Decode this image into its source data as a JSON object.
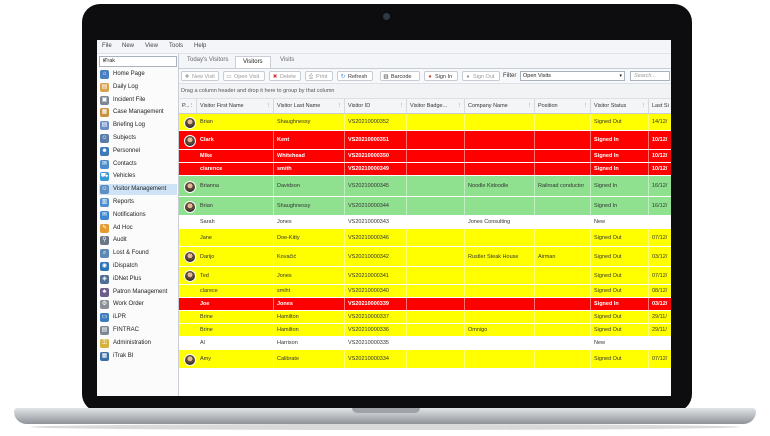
{
  "menu": [
    "File",
    "New",
    "View",
    "Tools",
    "Help"
  ],
  "sidebar": {
    "header": "iTrak",
    "items": [
      {
        "label": "Home Page",
        "icon": "home-icon",
        "color": "#4a7fc1"
      },
      {
        "label": "Daily Log",
        "icon": "daily-log-icon",
        "color": "#d9a14a"
      },
      {
        "label": "Incident File",
        "icon": "incident-file-icon",
        "color": "#7b8593"
      },
      {
        "label": "Case Management",
        "icon": "case-management-icon",
        "color": "#c9913d"
      },
      {
        "label": "Briefing Log",
        "icon": "briefing-log-icon",
        "color": "#6b8fc4"
      },
      {
        "label": "Subjects",
        "icon": "subjects-icon",
        "color": "#5a7ca8"
      },
      {
        "label": "Personnel",
        "icon": "personnel-icon",
        "color": "#3f7bb8"
      },
      {
        "label": "Contacts",
        "icon": "contacts-icon",
        "color": "#4c8bc9"
      },
      {
        "label": "Vehicles",
        "icon": "vehicles-icon",
        "color": "#3a9ad9"
      },
      {
        "label": "Visitor Management",
        "icon": "visitor-management-icon",
        "color": "#5f8ec2",
        "active": true
      },
      {
        "label": "Reports",
        "icon": "reports-icon",
        "color": "#4d8fd1"
      },
      {
        "label": "Notifications",
        "icon": "notifications-icon",
        "color": "#3f86d0"
      },
      {
        "label": "Ad Hoc",
        "icon": "ad-hoc-icon",
        "color": "#e39b2d"
      },
      {
        "label": "Audit",
        "icon": "audit-icon",
        "color": "#6a7686"
      },
      {
        "label": "Lost & Found",
        "icon": "lost-found-icon",
        "color": "#5e88b6"
      },
      {
        "label": "iDispatch",
        "icon": "idispatch-icon",
        "color": "#2f74b5"
      },
      {
        "label": "iDNet Plus",
        "icon": "idnet-plus-icon",
        "color": "#4e6f93"
      },
      {
        "label": "Patron Management",
        "icon": "patron-management-icon",
        "color": "#6b5f8a"
      },
      {
        "label": "Work Order",
        "icon": "work-order-icon",
        "color": "#8a8f96"
      },
      {
        "label": "iLPR",
        "icon": "ilpr-icon",
        "color": "#3d7dbf"
      },
      {
        "label": "FINTRAC",
        "icon": "fintrac-icon",
        "color": "#7d8793"
      },
      {
        "label": "Administration",
        "icon": "administration-icon",
        "color": "#d8b13a"
      },
      {
        "label": "iTrak BI",
        "icon": "itrak-bi-icon",
        "color": "#3c6fa6"
      }
    ]
  },
  "tabs": [
    {
      "label": "Today's Visitors"
    },
    {
      "label": "Visitors",
      "active": true
    },
    {
      "label": "Visits"
    }
  ],
  "toolbar": {
    "new_visit": "New Visit",
    "open_visit": "Open Visit",
    "delete": "Delete",
    "print": "Print",
    "refresh": "Refresh",
    "barcode": "Barcode",
    "sign_in": "Sign In",
    "sign_out": "Sign Out",
    "filter_label": "Filter",
    "filter_value": "Open Visits",
    "search_placeholder": "Search..."
  },
  "group_hint": "Drag a column header and drop it here to group by that column",
  "columns": [
    "P...",
    "Visitor First Name",
    "Visitor Last Name",
    "Visitor ID",
    "Visitor Badge...",
    "Company Name",
    "Position",
    "Visitor Status",
    "Last Si"
  ],
  "status_colors": {
    "yellow": "#ffff00",
    "red": "#ff0000",
    "green": "#8fe08f",
    "white": "#ffffff"
  },
  "rows": [
    {
      "first": "Brian",
      "last": "Shaughnessy",
      "id": "VS20210000352",
      "badge": "",
      "company": "",
      "position": "",
      "status": "Signed Out",
      "last_sign": "14/12/",
      "color": "yellow",
      "photo": true
    },
    {
      "first": "Clark",
      "last": "Kent",
      "id": "VS20210000351",
      "badge": "",
      "company": "",
      "position": "",
      "status": "Signed In",
      "last_sign": "10/12/",
      "color": "red",
      "photo": true
    },
    {
      "first": "Mike",
      "last": "Whitehead",
      "id": "VS20210000350",
      "badge": "",
      "company": "",
      "position": "",
      "status": "Signed In",
      "last_sign": "10/12/",
      "color": "red",
      "photo": false
    },
    {
      "first": "clarence",
      "last": "smith",
      "id": "VS20210000349",
      "badge": "",
      "company": "",
      "position": "",
      "status": "Signed In",
      "last_sign": "10/12/",
      "color": "red",
      "photo": false
    },
    {
      "first": "Brianna",
      "last": "Davidson",
      "id": "VS20210000345",
      "badge": "",
      "company": "Noodle Kidoodle",
      "position": "Railroad conductor",
      "status": "Signed In",
      "last_sign": "16/12/",
      "color": "green",
      "photo": true
    },
    {
      "first": "Brian",
      "last": "Shaughnessy",
      "id": "VS20210000344",
      "badge": "",
      "company": "",
      "position": "",
      "status": "Signed In",
      "last_sign": "16/12/",
      "color": "green",
      "photo": true
    },
    {
      "first": "Sarah",
      "last": "Jones",
      "id": "VS20210000343",
      "badge": "",
      "company": "Jones Consulting",
      "position": "",
      "status": "New",
      "last_sign": "",
      "color": "white",
      "photo": false
    },
    {
      "first": "Jane",
      "last": "Doe-Kitty",
      "id": "VS20210000346",
      "badge": "",
      "company": "",
      "position": "",
      "status": "Signed Out",
      "last_sign": "07/12/",
      "color": "yellow",
      "photo": false
    },
    {
      "first": "Darijo",
      "last": "Kovačić",
      "id": "VS20210000342",
      "badge": "",
      "company": "Rustler Steak House",
      "position": "Airman",
      "status": "Signed Out",
      "last_sign": "03/12/",
      "color": "yellow",
      "photo": true
    },
    {
      "first": "Ted",
      "last": "Jones",
      "id": "VS20210000341",
      "badge": "",
      "company": "",
      "position": "",
      "status": "Signed Out",
      "last_sign": "07/12/",
      "color": "yellow",
      "photo": true
    },
    {
      "first": "clarece",
      "last": "smiht",
      "id": "VS20210000340",
      "badge": "",
      "company": "",
      "position": "",
      "status": "Signed Out",
      "last_sign": "08/12/",
      "color": "yellow",
      "photo": false
    },
    {
      "first": "Joe",
      "last": "Jones",
      "id": "VS20210000339",
      "badge": "",
      "company": "",
      "position": "",
      "status": "Signed In",
      "last_sign": "03/12/",
      "color": "red",
      "photo": false
    },
    {
      "first": "Brine",
      "last": "Hamilton",
      "id": "VS20210000337",
      "badge": "",
      "company": "",
      "position": "",
      "status": "Signed Out",
      "last_sign": "29/11/",
      "color": "yellow",
      "photo": false
    },
    {
      "first": "Brine",
      "last": "Hamilton",
      "id": "VS20210000336",
      "badge": "",
      "company": "Omnigo",
      "position": "",
      "status": "Signed Out",
      "last_sign": "29/11/",
      "color": "yellow",
      "photo": false
    },
    {
      "first": "Al",
      "last": "Harrison",
      "id": "VS20210000335",
      "badge": "",
      "company": "",
      "position": "",
      "status": "New",
      "last_sign": "",
      "color": "white",
      "photo": false
    },
    {
      "first": "Amy",
      "last": "Calibrate",
      "id": "VS20210000334",
      "badge": "",
      "company": "",
      "position": "",
      "status": "Signed Out",
      "last_sign": "07/12/",
      "color": "yellow",
      "photo": true
    }
  ]
}
